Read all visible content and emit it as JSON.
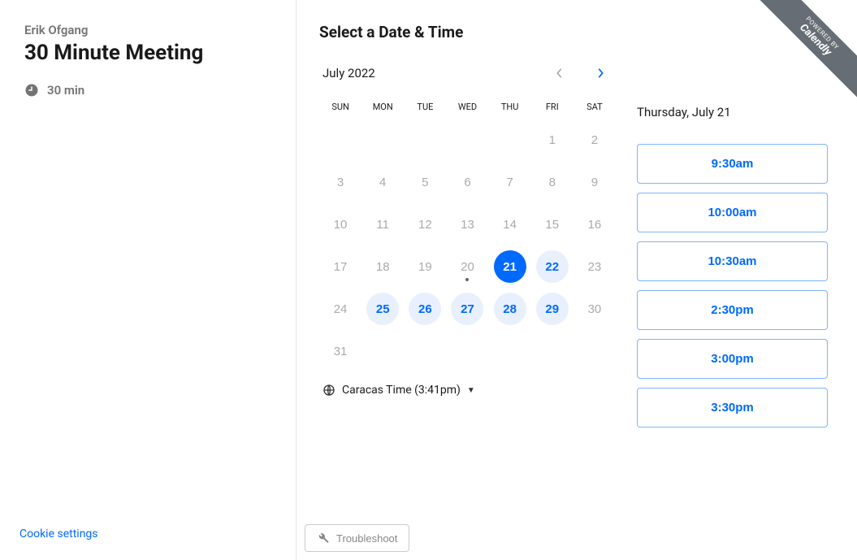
{
  "host": {
    "name": "Erik Ofgang"
  },
  "meeting": {
    "title": "30 Minute Meeting",
    "duration_label": "30 min"
  },
  "cookie_link": "Cookie settings",
  "section_title": "Select a Date & Time",
  "month_label": "July 2022",
  "weekdays": [
    "SUN",
    "MON",
    "TUE",
    "WED",
    "THU",
    "FRI",
    "SAT"
  ],
  "calendar": {
    "leading_blanks": 5,
    "days": [
      {
        "n": 1,
        "state": "disabled"
      },
      {
        "n": 2,
        "state": "disabled"
      },
      {
        "n": 3,
        "state": "disabled"
      },
      {
        "n": 4,
        "state": "disabled"
      },
      {
        "n": 5,
        "state": "disabled"
      },
      {
        "n": 6,
        "state": "disabled"
      },
      {
        "n": 7,
        "state": "disabled"
      },
      {
        "n": 8,
        "state": "disabled"
      },
      {
        "n": 9,
        "state": "disabled"
      },
      {
        "n": 10,
        "state": "disabled"
      },
      {
        "n": 11,
        "state": "disabled"
      },
      {
        "n": 12,
        "state": "disabled"
      },
      {
        "n": 13,
        "state": "disabled"
      },
      {
        "n": 14,
        "state": "disabled"
      },
      {
        "n": 15,
        "state": "disabled"
      },
      {
        "n": 16,
        "state": "disabled"
      },
      {
        "n": 17,
        "state": "disabled"
      },
      {
        "n": 18,
        "state": "disabled"
      },
      {
        "n": 19,
        "state": "disabled"
      },
      {
        "n": 20,
        "state": "disabled",
        "today": true
      },
      {
        "n": 21,
        "state": "selected"
      },
      {
        "n": 22,
        "state": "available"
      },
      {
        "n": 23,
        "state": "disabled"
      },
      {
        "n": 24,
        "state": "disabled"
      },
      {
        "n": 25,
        "state": "available"
      },
      {
        "n": 26,
        "state": "available"
      },
      {
        "n": 27,
        "state": "available"
      },
      {
        "n": 28,
        "state": "available"
      },
      {
        "n": 29,
        "state": "available"
      },
      {
        "n": 30,
        "state": "disabled"
      },
      {
        "n": 31,
        "state": "disabled"
      }
    ]
  },
  "timezone_label": "Caracas Time (3:41pm)",
  "selected_date_label": "Thursday, July 21",
  "timeslots": [
    "9:30am",
    "10:00am",
    "10:30am",
    "2:30pm",
    "3:00pm",
    "3:30pm"
  ],
  "troubleshoot_label": "Troubleshoot",
  "powered": {
    "by": "POWERED BY",
    "brand": "Calendly"
  }
}
